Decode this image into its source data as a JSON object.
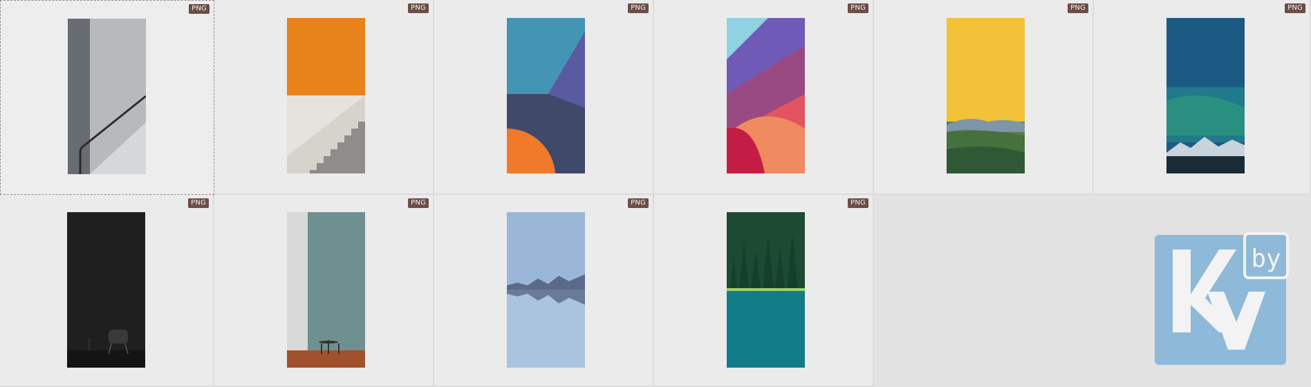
{
  "gallery": {
    "items": [
      {
        "id": "img-stairs-grey",
        "format": "PNG"
      },
      {
        "id": "img-orange-stairs",
        "format": "PNG"
      },
      {
        "id": "img-blue-geometric",
        "format": "PNG"
      },
      {
        "id": "img-red-curves",
        "format": "PNG"
      },
      {
        "id": "img-yellow-hills",
        "format": "PNG"
      },
      {
        "id": "img-aurora-night",
        "format": "PNG"
      },
      {
        "id": "img-dark-chair",
        "format": "PNG"
      },
      {
        "id": "img-teal-room",
        "format": "PNG"
      },
      {
        "id": "img-lake-mountains",
        "format": "PNG"
      },
      {
        "id": "img-forest-lake",
        "format": "PNG"
      }
    ],
    "selected_index": 0
  },
  "watermark": {
    "logo_text": "Kv",
    "sub_text": "by",
    "color": "#8fb9d8"
  },
  "colors": {
    "badge": "#6b4e47",
    "cell_bg": "#ebebeb"
  }
}
